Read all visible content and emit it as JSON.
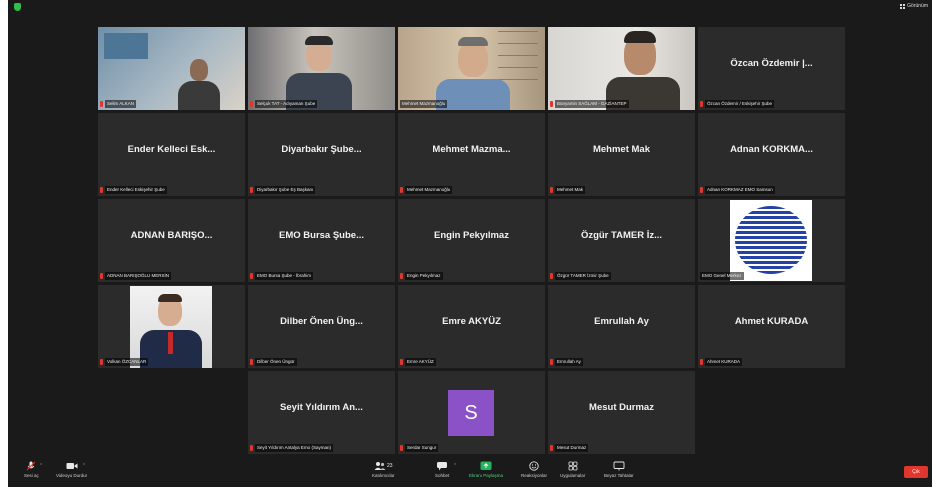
{
  "window": {
    "view_label": "Görünüm"
  },
  "colors": {
    "active_speaker": "#c6e05c",
    "mic_muted": "#e0362e",
    "end_button": "#e0362e",
    "avatar_s": "#8a52c6"
  },
  "participants": [
    {
      "name_label": "Selim ALKAN",
      "display": "",
      "video": true
    },
    {
      "name_label": "Selçuk TAT - Adıyaman Şube",
      "display": "",
      "video": true
    },
    {
      "name_label": "Mehmet Mazmanoğlu",
      "display": "",
      "video": true,
      "active_speaker": true
    },
    {
      "name_label": "Bünyamin SAĞLAM - GAZİANTEP",
      "display": "",
      "video": true
    },
    {
      "name_label": "Özcan Özdemir / Eskişehir Şube",
      "display": "Özcan Özdemir |..."
    },
    {
      "name_label": "Ender Kelleci Eskişehir Şube",
      "display": "Ender Kelleci Esk..."
    },
    {
      "name_label": "Diyarbakır Şube Eş Başkanı",
      "display": "Diyarbakır Şube..."
    },
    {
      "name_label": "Mehmet Mazmanoğlu",
      "display": "Mehmet Mazma..."
    },
    {
      "name_label": "Mehmet Mak",
      "display": "Mehmet Mak"
    },
    {
      "name_label": "Adnan KORKMAZ EMO Samsun",
      "display": "Adnan KORKMA..."
    },
    {
      "name_label": "ADNAN BARIŞOĞLU MERSİN",
      "display": "ADNAN BARIŞO..."
    },
    {
      "name_label": "EMO Bursa Şube - İbrahim",
      "display": "EMO Bursa Şube..."
    },
    {
      "name_label": "Engin Pekyılmaz",
      "display": "Engin Pekyılmaz"
    },
    {
      "name_label": "Özgür TAMER İzmir Şube",
      "display": "Özgür TAMER İz..."
    },
    {
      "name_label": "EMO Genel Merkez",
      "display": "",
      "logo": true
    },
    {
      "name_label": "Volkan ÖZCANLAR",
      "display": "",
      "video": true
    },
    {
      "name_label": "Dilber Önen Üngür",
      "display": "Dilber Önen Üng..."
    },
    {
      "name_label": "Emre AKYÜZ",
      "display": "Emre AKYÜZ"
    },
    {
      "name_label": "Emrullah Ay",
      "display": "Emrullah Ay"
    },
    {
      "name_label": "Ahmet KURADA",
      "display": "Ahmet KURADA"
    },
    {
      "name_label": "Seyit Yıldırım Antalya Emo (Sayman)",
      "display": "Seyit Yıldırım An..."
    },
    {
      "name_label": "Serdar Sungur",
      "display": "",
      "avatar": "S"
    },
    {
      "name_label": "Mesut Durmaz",
      "display": "Mesut Durmaz"
    }
  ],
  "toolbar": {
    "mute": "Sesi aç",
    "video": "Videoyu Durdur",
    "participants": "Katılımcılar",
    "participants_count": "23",
    "chat": "Sohbet",
    "share": "Ekranı Paylaşma",
    "reactions": "Reaksiyonlar",
    "apps": "Uygulamalar",
    "whiteboard": "Beyaz Tahtalar",
    "end": "Çık"
  }
}
